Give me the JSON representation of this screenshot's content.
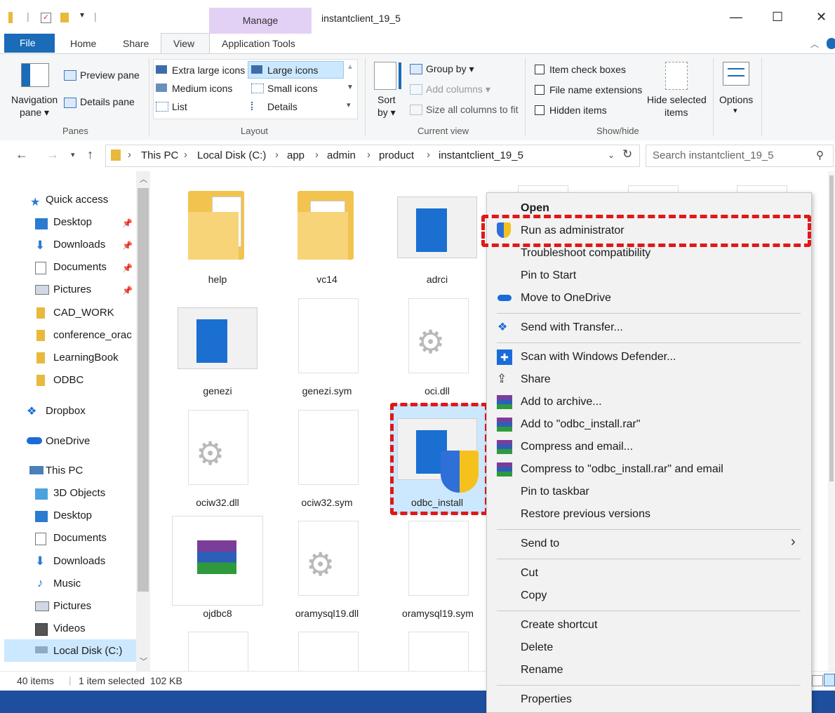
{
  "window": {
    "title": "instantclient_19_5",
    "manage_label": "Manage",
    "controls": {
      "minimize": "—",
      "maximize": "☐",
      "close": "✕"
    }
  },
  "ribbon_tabs": [
    "File",
    "Home",
    "Share",
    "View",
    "Application Tools"
  ],
  "ribbon": {
    "panes": {
      "navigation_pane": "Navigation",
      "navigation_pane_2": "pane ▾",
      "preview_pane": "Preview pane",
      "details_pane": "Details pane",
      "group": "Panes"
    },
    "layout": {
      "items": [
        "Extra large icons",
        "Large icons",
        "Medium icons",
        "Small icons",
        "List",
        "Details"
      ],
      "group": "Layout"
    },
    "current_view": {
      "sort_by": "Sort",
      "sort_by_2": "by ▾",
      "group_by": "Group by ▾",
      "add_columns": "Add columns ▾",
      "size_all_columns": "Size all columns to fit",
      "group": "Current view"
    },
    "show_hide": {
      "item_check_boxes": "Item check boxes",
      "file_name_extensions": "File name extensions",
      "hidden_items": "Hidden items",
      "hide_selected": "Hide selected",
      "hide_selected_2": "items",
      "group": "Show/hide"
    },
    "options": {
      "label": "Options",
      "arrow": "▾"
    }
  },
  "address": {
    "crumbs": [
      "This PC",
      "Local Disk (C:)",
      "app",
      "admin",
      "product",
      "instantclient_19_5"
    ],
    "search_placeholder": "Search instantclient_19_5"
  },
  "nav": {
    "quick_access": "Quick access",
    "quick_items": [
      "Desktop",
      "Downloads",
      "Documents",
      "Pictures",
      "CAD_WORK",
      "conference_orac",
      "LearningBook",
      "ODBC"
    ],
    "dropbox": "Dropbox",
    "onedrive": "OneDrive",
    "this_pc": "This PC",
    "pc_items": [
      "3D Objects",
      "Desktop",
      "Documents",
      "Downloads",
      "Music",
      "Pictures",
      "Videos",
      "Local Disk (C:)"
    ]
  },
  "files": [
    "help",
    "vc14",
    "adrci",
    "genezi",
    "genezi.sym",
    "oci.dll",
    "ociw32.dll",
    "ociw32.sym",
    "odbc_install",
    "ojdbc8",
    "oramysql19.dll",
    "oramysql19.sym"
  ],
  "status": {
    "items": "40 items",
    "selected": "1 item selected  102 KB"
  },
  "context_menu": {
    "open": "Open",
    "run_as_admin": "Run as administrator",
    "troubleshoot": "Troubleshoot compatibility",
    "pin_start": "Pin to Start",
    "move_onedrive": "Move to OneDrive",
    "send_transfer": "Send with Transfer...",
    "scan_defender": "Scan with Windows Defender...",
    "share": "Share",
    "add_archive": "Add to archive...",
    "add_rar": "Add to \"odbc_install.rar\"",
    "compress_email": "Compress and email...",
    "compress_rar_email": "Compress to \"odbc_install.rar\" and email",
    "pin_taskbar": "Pin to taskbar",
    "restore_versions": "Restore previous versions",
    "send_to": "Send to",
    "cut": "Cut",
    "copy": "Copy",
    "create_shortcut": "Create shortcut",
    "delete": "Delete",
    "rename": "Rename",
    "properties": "Properties"
  },
  "colors": {
    "highlight": "#e01818",
    "accent": "#1a6bb8",
    "selection": "#cce8ff"
  }
}
